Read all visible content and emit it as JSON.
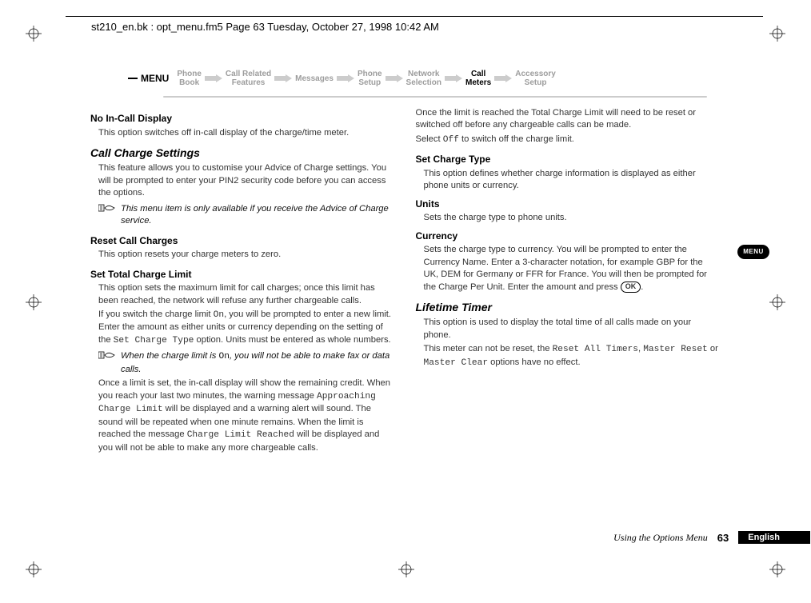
{
  "header": {
    "running_head": "st210_en.bk : opt_menu.fm5  Page 63  Tuesday, October 27, 1998  10:42 AM"
  },
  "nav": {
    "menu_label": "MENU",
    "items": [
      {
        "line1": "Phone",
        "line2": "Book",
        "active": false
      },
      {
        "line1": "Call Related",
        "line2": "Features",
        "active": false
      },
      {
        "line1": "Messages",
        "line2": "",
        "active": false
      },
      {
        "line1": "Phone",
        "line2": "Setup",
        "active": false
      },
      {
        "line1": "Network",
        "line2": "Selection",
        "active": false
      },
      {
        "line1": "Call",
        "line2": "Meters",
        "active": true
      },
      {
        "line1": "Accessory",
        "line2": "Setup",
        "active": false
      }
    ]
  },
  "left": {
    "h_noincall": "No In-Call Display",
    "p_noincall": "This option switches off in-call display of the charge/time meter.",
    "h_ccs": "Call Charge Settings",
    "p_ccs": "This feature allows you to customise your Advice of Charge settings. You will be prompted to enter your PIN2 security code before you can access the options.",
    "note_ccs": "This menu item is only available if you receive the Advice of Charge service.",
    "h_reset": "Reset Call Charges",
    "p_reset": "This option resets your charge meters to zero.",
    "h_limit": "Set Total Charge Limit",
    "p_limit1": "This option sets the maximum limit for call charges; once this limit has been reached, the network will refuse any further chargeable calls.",
    "p_limit2a": "If you switch the charge limit ",
    "mono_on1": "On",
    "p_limit2b": ", you will be prompted to enter a new limit. Enter the amount as either units or currency depending on the setting of the ",
    "mono_sct": "Set Charge Type",
    "p_limit2c": " option. Units must be entered as whole numbers.",
    "note_limit_a": "When the charge limit is ",
    "note_limit_mono": "On",
    "note_limit_b": ", you will not be able to make fax or data calls.",
    "p_limit3a": "Once a limit is set, the in-call display will show the remaining credit. When you reach your last two minutes, the warning message ",
    "mono_appr": "Approaching Charge Limit",
    "p_limit3b": " will be displayed and a warning alert will sound. The sound will be repeated when one minute remains. When the limit is reached the message ",
    "mono_clr": "Charge Limit Reached",
    "p_limit3c": "  will be displayed and you will not be able to make any more chargeable calls."
  },
  "right": {
    "p_intro1": "Once the limit is reached the Total Charge Limit will need to be reset or switched off before any chargeable calls can be made.",
    "p_intro2a": "Select ",
    "mono_off": "Off",
    "p_intro2b": " to switch off the charge limit.",
    "h_sct": "Set Charge Type",
    "p_sct": "This option defines whether charge information is displayed as either phone units or currency.",
    "h_units": "Units",
    "p_units": "Sets the charge type to phone units.",
    "h_curr": "Currency",
    "p_curr_a": "Sets the charge type to currency. You will be prompted to enter the Currency Name. Enter a 3-character notation, for example GBP for the UK, DEM  for Germany or FFR for France. You will then be prompted for the Charge Per Unit. Enter the amount and press ",
    "ok_label": "OK",
    "p_curr_b": ".",
    "h_lt": "Lifetime Timer",
    "p_lt1": "This option is used to display the total time of all calls made on your phone.",
    "p_lt2a": "This meter can not be reset, the ",
    "mono_rat": "Reset All Timers",
    "p_lt2b": ", ",
    "mono_mr": "Master Reset",
    "p_lt2c": " or ",
    "mono_mc": "Master Clear",
    "p_lt2d": " options have no effect."
  },
  "side_tab": "MENU",
  "footer": {
    "chapter": "Using the Options Menu",
    "page": "63",
    "lang": "English"
  }
}
